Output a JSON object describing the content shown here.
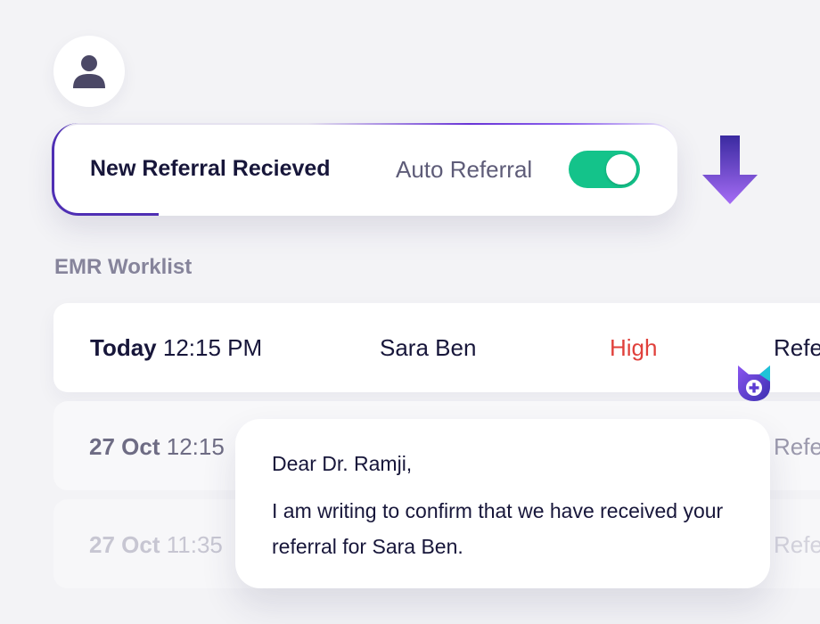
{
  "notification": {
    "title": "New Referral Recieved",
    "auto_label": "Auto Referral",
    "auto_enabled": true
  },
  "worklist": {
    "title": "EMR Worklist",
    "rows": [
      {
        "date": "Today",
        "time": "12:15 PM",
        "name": "Sara Ben",
        "priority": "High",
        "type": "Refe"
      },
      {
        "date": "27 Oct",
        "time": "12:15",
        "type": "Refe"
      },
      {
        "date": "27 Oct",
        "time": "11:35",
        "type": "Refe"
      }
    ]
  },
  "letter": {
    "greeting": "Dear Dr. Ramji,",
    "body": "I am writing to confirm that we have received your referral for Sara Ben."
  },
  "colors": {
    "accent": "#6a35d9",
    "toggle_on": "#14c38a",
    "priority_high": "#e0403b"
  },
  "icons": [
    "user-icon",
    "down-arrow-icon",
    "shield-plus-icon"
  ]
}
